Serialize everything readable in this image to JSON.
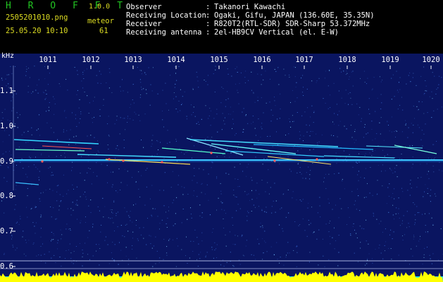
{
  "app": {
    "title": "H R O F F T",
    "version": "1.0.0"
  },
  "file": {
    "name": "2505201010.png",
    "datetime": "25.05.20 10:10"
  },
  "meteor": {
    "label": "meteor",
    "count": "61"
  },
  "info": [
    {
      "key": "Observer",
      "value": "Takanori Kawachi"
    },
    {
      "key": "Receiving Location",
      "value": "Ogaki, Gifu, JAPAN (136.60E, 35.35N)"
    },
    {
      "key": "Receiver",
      "value": "R820T2(RTL-SDR) SDR-Sharp 53.372MHz"
    },
    {
      "key": "Receiving antenna",
      "value": "2el-HB9CV Vertical (el. E-W)"
    }
  ],
  "info_sep": ":",
  "spectrogram": {
    "y_unit": "kHz",
    "x_ticks": [
      "1011",
      "1012",
      "1013",
      "1014",
      "1015",
      "1016",
      "1017",
      "1018",
      "1019",
      "1020"
    ],
    "y_ticks": [
      "1.1",
      "1.0",
      "0.9",
      "0.8",
      "0.7",
      "0.6"
    ],
    "colors": {
      "background": "#0a1560",
      "carrier": "#3cc8ff",
      "level_fill": "#ffff00",
      "level_base": "#00e0ff"
    }
  }
}
